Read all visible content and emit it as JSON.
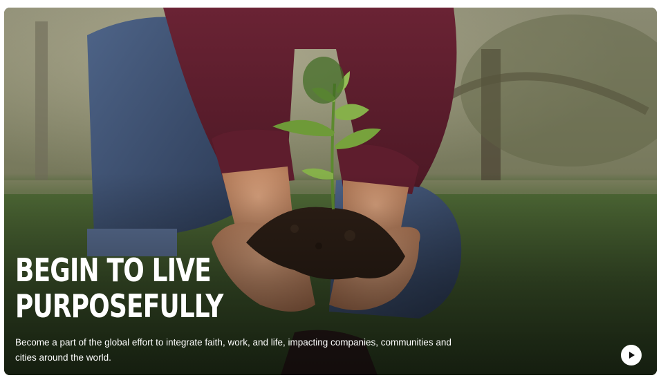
{
  "hero": {
    "title_line1": "BEGIN TO LIVE",
    "title_line2": "PURPOSEFULLY",
    "description": "Become a part of the global effort to integrate faith, work, and life, impacting companies, communities and cities around the world.",
    "image_subject": "hands holding a seedling in soil",
    "play_icon": "play-icon"
  },
  "colors": {
    "text": "#ffffff",
    "play_button_bg": "#ffffff",
    "play_icon": "#111111"
  }
}
